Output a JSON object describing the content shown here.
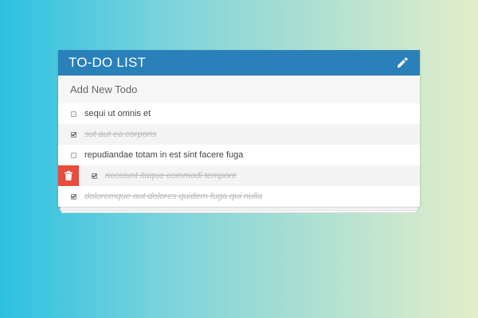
{
  "header": {
    "title": "TO-DO LIST",
    "edit_icon": "pencil-icon",
    "background": "#2a80b9"
  },
  "add_todo": {
    "placeholder": "Add New Todo",
    "value": ""
  },
  "todos": [
    {
      "text": "sequi ut omnis et",
      "completed": false
    },
    {
      "text": "sut aut ea corporis",
      "completed": true
    },
    {
      "text": "repudiandae totam in est sint facere fuga",
      "completed": false
    },
    {
      "text": "necciunt itaque commodi tempore",
      "completed": true,
      "hovered": true,
      "delete_icon": "trash-icon"
    },
    {
      "text": "doloremque aut dolores quidem fuga qui nulla",
      "completed": true
    }
  ],
  "colors": {
    "delete": "#e74c3c",
    "background_left": "#2cc1e2",
    "background_right": "#e3edca"
  }
}
